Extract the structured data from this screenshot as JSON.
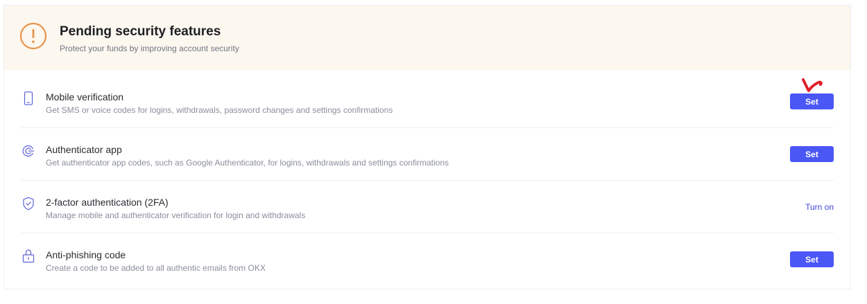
{
  "banner": {
    "title": "Pending security features",
    "subtitle": "Protect your funds by improving account security",
    "icon": "warning-icon",
    "accent_color": "#e6934a",
    "background": "#fcf7ef"
  },
  "features": [
    {
      "icon": "mobile-phone-icon",
      "title": "Mobile verification",
      "description": "Get SMS or voice codes for logins, withdrawals, password changes and settings confirmations",
      "action_label": "Set"
    },
    {
      "icon": "authenticator-icon",
      "title": "Authenticator app",
      "description": "Get authenticator app codes, such as Google Authenticator, for logins, withdrawals and settings confirmations",
      "action_label": "Set"
    },
    {
      "icon": "shield-check-icon",
      "title": "2-factor authentication (2FA)",
      "description": "Manage mobile and authenticator verification for login and withdrawals",
      "action_label": "Turn on"
    },
    {
      "icon": "lock-icon",
      "title": "Anti-phishing code",
      "description": "Create a code to be added to all authentic emails from OKX",
      "action_label": "Set"
    }
  ],
  "colors": {
    "primary_button": "#4a57f5",
    "link": "#3b45d9",
    "annotation_mark": "#e0212b",
    "icon_stroke": "#5a61d6"
  }
}
